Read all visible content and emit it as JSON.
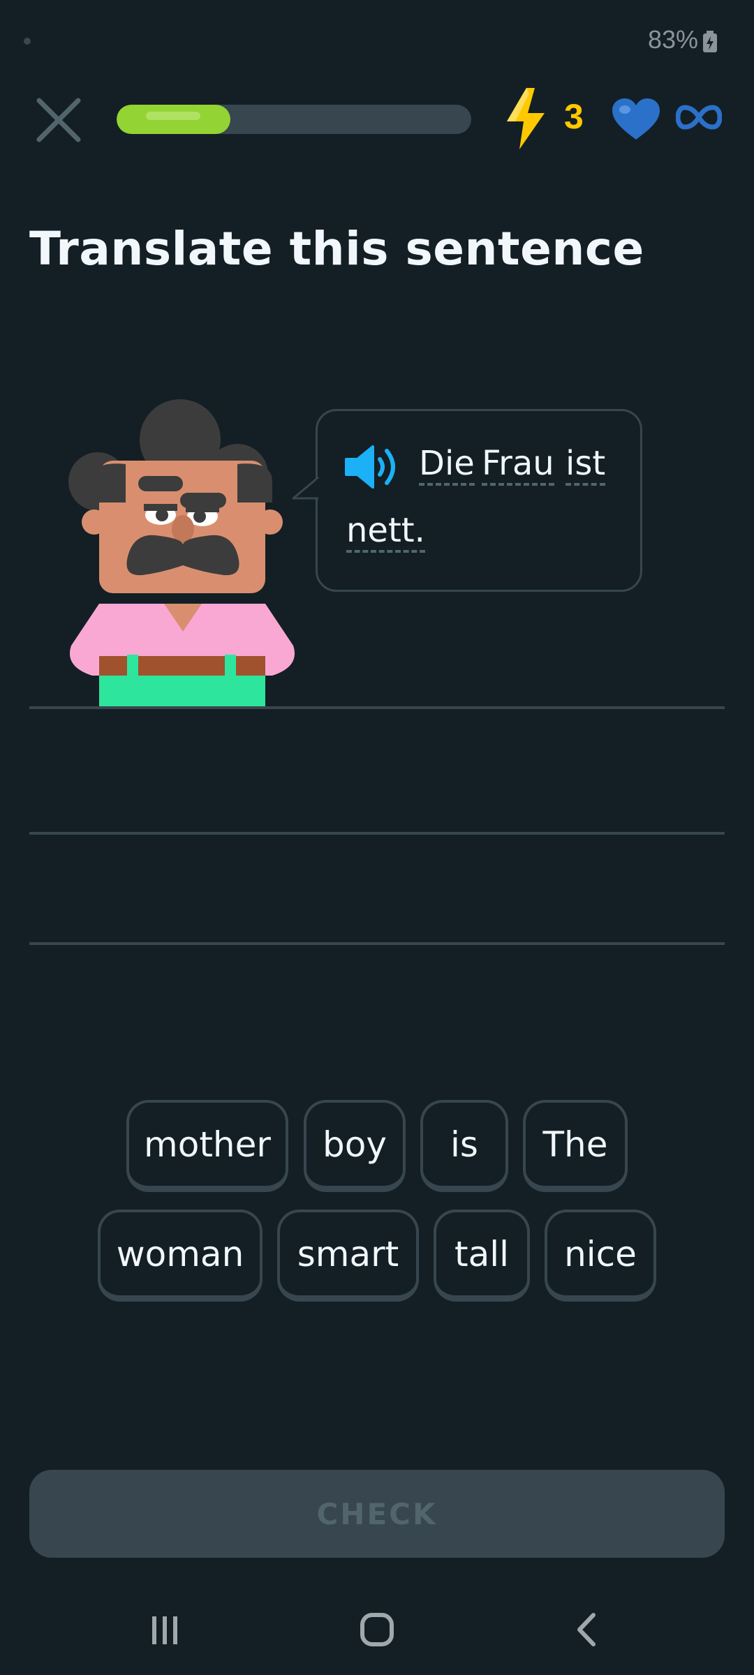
{
  "status_bar": {
    "battery": "83%"
  },
  "lesson": {
    "progress": 0.32,
    "streak_count": "3",
    "hearts": "infinite"
  },
  "title": "Translate this sentence",
  "prompt": {
    "words": [
      "Die",
      "Frau",
      "ist",
      "nett."
    ]
  },
  "word_bank": {
    "row1": [
      "mother",
      "boy",
      "is",
      "The"
    ],
    "row2": [
      "woman",
      "smart",
      "tall",
      "nice"
    ]
  },
  "check_label": "CHECK",
  "icons": {
    "close": "close-icon",
    "streak": "lightning-bolt-icon",
    "hearts": "heart-icon",
    "infinity": "infinity-icon",
    "speaker": "speaker-icon"
  },
  "colors": {
    "background": "#131f24",
    "progress": "#93d333",
    "streak": "#ffc800",
    "heart": "#2b70c9",
    "speaker": "#1cb0f6",
    "border": "#37464f"
  }
}
